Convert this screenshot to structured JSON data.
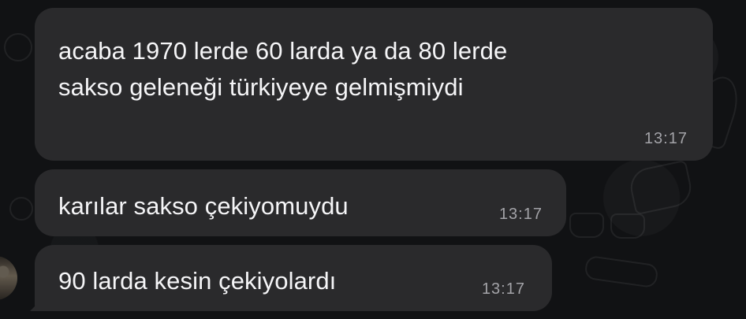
{
  "chat": {
    "messages": [
      {
        "text": "acaba 1970 lerde 60 larda ya da 80 lerde\nsakso geleneği türkiyeye gelmişmiydi",
        "time": "13:17"
      },
      {
        "text": "karılar sakso çekiyomuydu",
        "time": "13:17"
      },
      {
        "text": "90 larda kesin çekiyolardı",
        "time": "13:17"
      }
    ]
  },
  "colors": {
    "background": "#111214",
    "bubble": "#2a2a2c",
    "text": "#f5f5f7",
    "timestamp": "#a3a3a8"
  }
}
